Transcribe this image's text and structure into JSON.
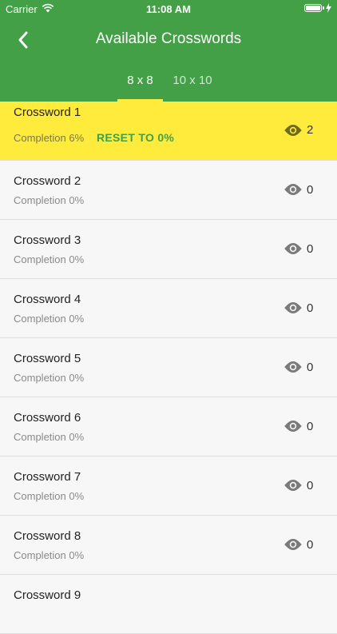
{
  "status": {
    "carrier": "Carrier",
    "time": "11:08 AM"
  },
  "header": {
    "title": "Available Crosswords"
  },
  "tabs": [
    {
      "label": "8 x 8"
    },
    {
      "label": "10 x 10"
    }
  ],
  "active": {
    "reset_label": "RESET TO 0%"
  },
  "crosswords": [
    {
      "name": "Crossword 1",
      "completion": "Completion 6%",
      "views": "2"
    },
    {
      "name": "Crossword 2",
      "completion": "Completion 0%",
      "views": "0"
    },
    {
      "name": "Crossword 3",
      "completion": "Completion 0%",
      "views": "0"
    },
    {
      "name": "Crossword 4",
      "completion": "Completion 0%",
      "views": "0"
    },
    {
      "name": "Crossword 5",
      "completion": "Completion 0%",
      "views": "0"
    },
    {
      "name": "Crossword 6",
      "completion": "Completion 0%",
      "views": "0"
    },
    {
      "name": "Crossword 7",
      "completion": "Completion 0%",
      "views": "0"
    },
    {
      "name": "Crossword 8",
      "completion": "Completion 0%",
      "views": "0"
    },
    {
      "name": "Crossword 9",
      "completion": "",
      "views": ""
    }
  ],
  "colors": {
    "primary": "#43a047",
    "highlight": "#ffeb3b"
  }
}
